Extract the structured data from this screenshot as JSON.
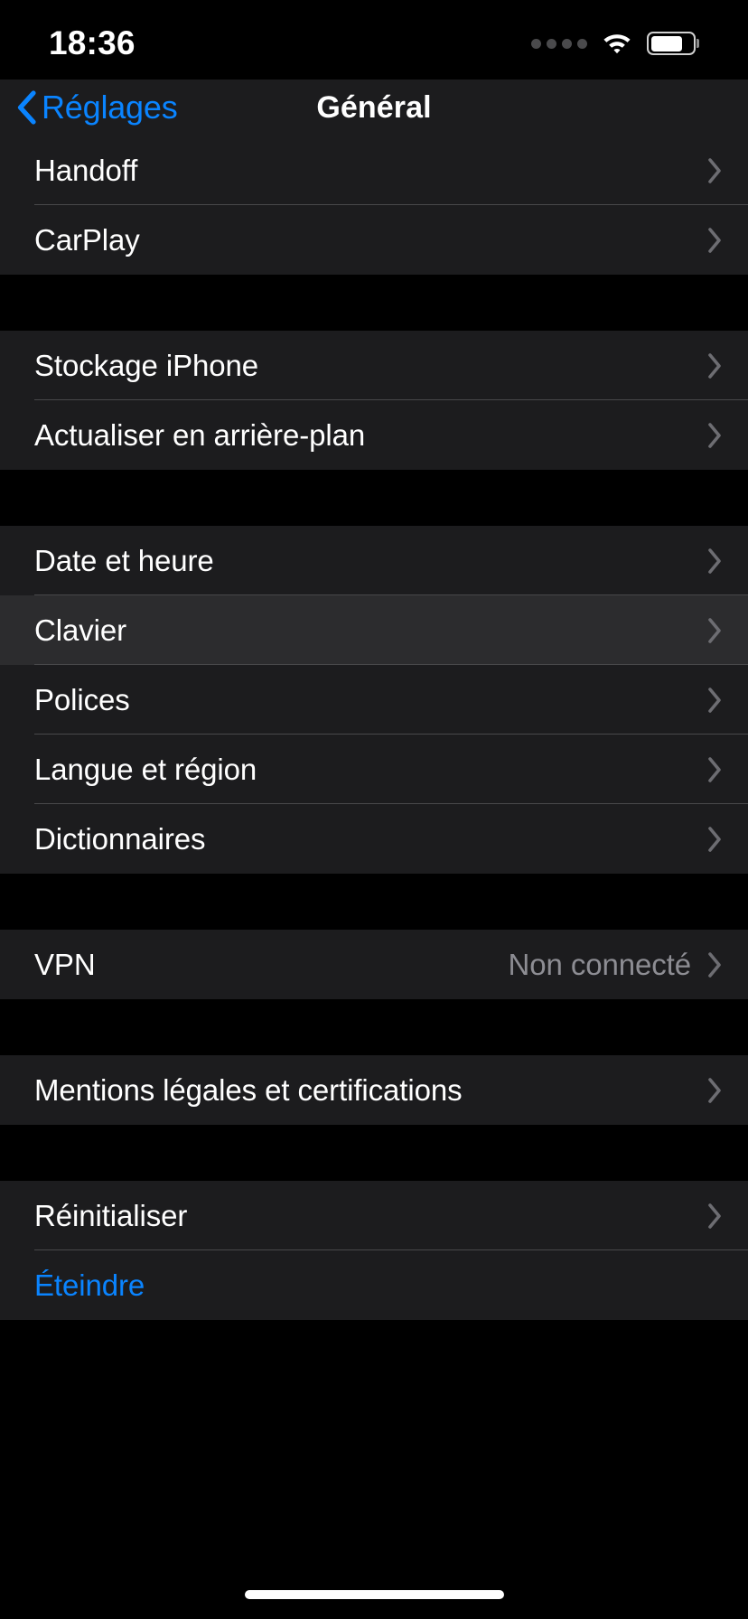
{
  "status_bar": {
    "time": "18:36",
    "cellular_icon": "signal-dots-icon",
    "wifi_icon": "wifi-icon",
    "battery_icon": "battery-icon",
    "battery_level_percent": 76
  },
  "nav_bar": {
    "back_label": "Réglages",
    "back_icon": "chevron-left-icon",
    "title": "Général"
  },
  "colors": {
    "accent_blue": "#0a84ff",
    "row_background": "#1c1c1e",
    "row_background_highlighted": "#2c2c2e",
    "page_background": "#000000",
    "separator": "#48484a",
    "secondary_text": "#8d8d93",
    "primary_text": "#ffffff"
  },
  "groups": [
    {
      "rows": [
        {
          "label": "Handoff",
          "value": "",
          "accessory": "chevron-right-icon",
          "highlighted": false
        },
        {
          "label": "CarPlay",
          "value": "",
          "accessory": "chevron-right-icon",
          "highlighted": false
        }
      ]
    },
    {
      "rows": [
        {
          "label": "Stockage iPhone",
          "value": "",
          "accessory": "chevron-right-icon",
          "highlighted": false
        },
        {
          "label": "Actualiser en arrière-plan",
          "value": "",
          "accessory": "chevron-right-icon",
          "highlighted": false
        }
      ]
    },
    {
      "rows": [
        {
          "label": "Date et heure",
          "value": "",
          "accessory": "chevron-right-icon",
          "highlighted": false
        },
        {
          "label": "Clavier",
          "value": "",
          "accessory": "chevron-right-icon",
          "highlighted": true
        },
        {
          "label": "Polices",
          "value": "",
          "accessory": "chevron-right-icon",
          "highlighted": false
        },
        {
          "label": "Langue et région",
          "value": "",
          "accessory": "chevron-right-icon",
          "highlighted": false
        },
        {
          "label": "Dictionnaires",
          "value": "",
          "accessory": "chevron-right-icon",
          "highlighted": false
        }
      ]
    },
    {
      "rows": [
        {
          "label": "VPN",
          "value": "Non connecté",
          "accessory": "chevron-right-icon",
          "highlighted": false
        }
      ]
    },
    {
      "rows": [
        {
          "label": "Mentions légales et certifications",
          "value": "",
          "accessory": "chevron-right-icon",
          "highlighted": false
        }
      ]
    },
    {
      "rows": [
        {
          "label": "Réinitialiser",
          "value": "",
          "accessory": "chevron-right-icon",
          "highlighted": false
        },
        {
          "label": "Éteindre",
          "value": "",
          "accessory": "none",
          "highlighted": false,
          "accent": true
        }
      ]
    }
  ],
  "home_indicator": "home-indicator"
}
